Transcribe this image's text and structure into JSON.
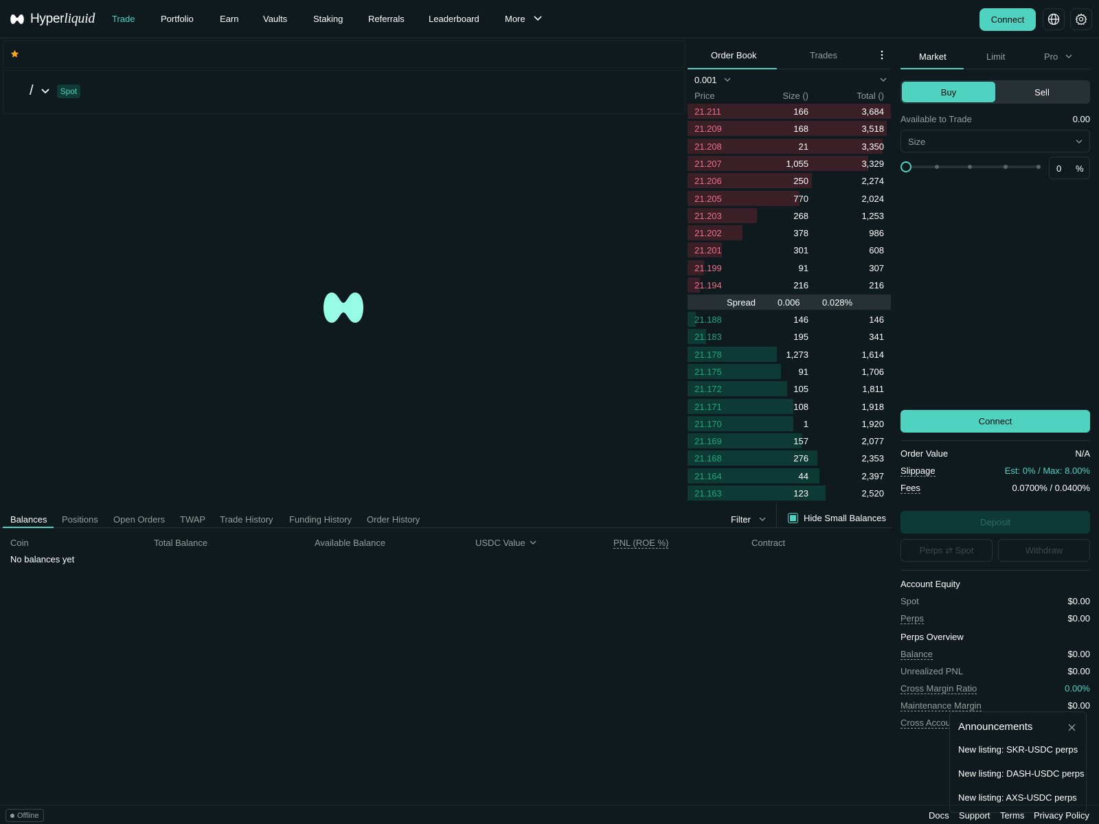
{
  "nav": {
    "logo_text": "Hyper",
    "logo_text_italic": "liquid",
    "items": [
      "Trade",
      "Portfolio",
      "Earn",
      "Vaults",
      "Staking",
      "Referrals",
      "Leaderboard",
      "More"
    ],
    "connect_label": "Connect"
  },
  "pair": {
    "slash": "/",
    "badge": "Spot"
  },
  "orderbook": {
    "tabs": [
      "Order Book",
      "Trades"
    ],
    "tick": "0.001",
    "headers": {
      "price": "Price",
      "size": "Size ()",
      "total": "Total ()"
    },
    "asks": [
      {
        "price": "21.211",
        "size": "166",
        "total": "3,684",
        "depth": 1.0
      },
      {
        "price": "21.209",
        "size": "168",
        "total": "3,518",
        "depth": 0.98
      },
      {
        "price": "21.208",
        "size": "21",
        "total": "3,350",
        "depth": 0.96
      },
      {
        "price": "21.207",
        "size": "1,055",
        "total": "3,329",
        "depth": 0.89
      },
      {
        "price": "21.206",
        "size": "250",
        "total": "2,274",
        "depth": 0.61
      },
      {
        "price": "21.205",
        "size": "770",
        "total": "2,024",
        "depth": 0.55
      },
      {
        "price": "21.203",
        "size": "268",
        "total": "1,253",
        "depth": 0.34
      },
      {
        "price": "21.202",
        "size": "378",
        "total": "986",
        "depth": 0.27
      },
      {
        "price": "21.201",
        "size": "301",
        "total": "608",
        "depth": 0.17
      },
      {
        "price": "21.199",
        "size": "91",
        "total": "307",
        "depth": 0.08
      },
      {
        "price": "21.194",
        "size": "216",
        "total": "216",
        "depth": 0.06
      }
    ],
    "spread": {
      "label": "Spread",
      "value": "0.006",
      "pct": "0.028%"
    },
    "bids": [
      {
        "price": "21.188",
        "size": "146",
        "total": "146",
        "depth": 0.04
      },
      {
        "price": "21.183",
        "size": "195",
        "total": "341",
        "depth": 0.09
      },
      {
        "price": "21.178",
        "size": "1,273",
        "total": "1,614",
        "depth": 0.44
      },
      {
        "price": "21.175",
        "size": "91",
        "total": "1,706",
        "depth": 0.46
      },
      {
        "price": "21.172",
        "size": "105",
        "total": "1,811",
        "depth": 0.49
      },
      {
        "price": "21.171",
        "size": "108",
        "total": "1,918",
        "depth": 0.52
      },
      {
        "price": "21.170",
        "size": "1",
        "total": "1,920",
        "depth": 0.52
      },
      {
        "price": "21.169",
        "size": "157",
        "total": "2,077",
        "depth": 0.56
      },
      {
        "price": "21.168",
        "size": "276",
        "total": "2,353",
        "depth": 0.64
      },
      {
        "price": "21.164",
        "size": "44",
        "total": "2,397",
        "depth": 0.65
      },
      {
        "price": "21.163",
        "size": "123",
        "total": "2,520",
        "depth": 0.68
      }
    ]
  },
  "form": {
    "order_tabs": [
      "Market",
      "Limit",
      "Pro"
    ],
    "buy": "Buy",
    "sell": "Sell",
    "available_label": "Available to Trade",
    "available_value": "0.00",
    "size_placeholder": "Size",
    "percent_value": "0",
    "percent_sign": "%",
    "connect": "Connect",
    "order_value_label": "Order Value",
    "order_value": "N/A",
    "slippage_label": "Slippage",
    "slippage_value": "Est: 0% / Max: 8.00%",
    "fees_label": "Fees",
    "fees_value": "0.0700% / 0.0400%"
  },
  "bottom": {
    "tabs": [
      "Balances",
      "Positions",
      "Open Orders",
      "TWAP",
      "Trade History",
      "Funding History",
      "Order History"
    ],
    "filter": "Filter",
    "hide_small": "Hide Small Balances",
    "columns": [
      "Coin",
      "Total Balance",
      "Available Balance",
      "USDC Value",
      "PNL (ROE %)",
      "Contract"
    ],
    "empty": "No balances yet"
  },
  "account": {
    "deposit": "Deposit",
    "perps_spot": "Perps ⇄ Spot",
    "withdraw": "Withdraw",
    "equity_title": "Account Equity",
    "spot_label": "Spot",
    "spot_value": "$0.00",
    "perps_label": "Perps",
    "perps_value": "$0.00",
    "overview_title": "Perps Overview",
    "balance_label": "Balance",
    "balance_value": "$0.00",
    "upnl_label": "Unrealized PNL",
    "upnl_value": "$0.00",
    "cmr_label": "Cross Margin Ratio",
    "cmr_value": "0.00%",
    "mm_label": "Maintenance Margin",
    "mm_value": "$0.00",
    "cal_label": "Cross Accou"
  },
  "announcements": {
    "title": "Announcements",
    "items": [
      "New listing: SKR-USDC perps",
      "New listing: DASH-USDC perps",
      "New listing: AXS-USDC perps"
    ]
  },
  "footer": {
    "status": "Offline",
    "links": [
      "Docs",
      "Support",
      "Terms",
      "Privacy Policy"
    ]
  },
  "colors": {
    "accent": "#50d2c1",
    "ask": "#ed7088",
    "bid": "#1fa67d",
    "bg": "#0f1a1f"
  }
}
